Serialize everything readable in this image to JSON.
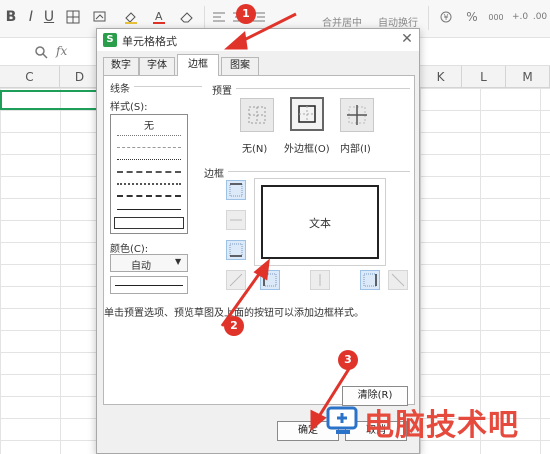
{
  "ribbon": {
    "merge_label": "合并居中",
    "wrap_label": "自动换行",
    "percent_label": "%",
    "thousands_label": "000"
  },
  "formula_bar": {
    "fx_label": "fx"
  },
  "columns": [
    "C",
    "D",
    "K",
    "L",
    "M"
  ],
  "dialog": {
    "title": "单元格格式",
    "tabs": [
      "数字",
      "字体",
      "边框",
      "图案"
    ],
    "active_tab": "边框",
    "line_group_label": "线条",
    "style_label": "样式(S):",
    "style_none_label": "无",
    "color_label": "颜色(C):",
    "color_value": "自动",
    "preset_group_label": "预置",
    "presets": [
      {
        "label": "无(N)",
        "icon": "preset-none-icon"
      },
      {
        "label": "外边框(O)",
        "icon": "preset-outline-icon"
      },
      {
        "label": "内部(I)",
        "icon": "preset-inside-icon"
      }
    ],
    "border_group_label": "边框",
    "preview_text": "文本",
    "hint_text": "单击预置选项、预览草图及上面的按钮可以添加边框样式。",
    "clear_button": "清除(R)",
    "ok_button": "确定",
    "cancel_button": "取消"
  },
  "annotations": [
    "1",
    "2",
    "3"
  ],
  "watermark": {
    "text": "电脑技术吧"
  },
  "colors": {
    "accent_green": "#1f9e5a",
    "annotation_red": "#e0332a",
    "border_btn_blue": "#dbe9f8"
  }
}
